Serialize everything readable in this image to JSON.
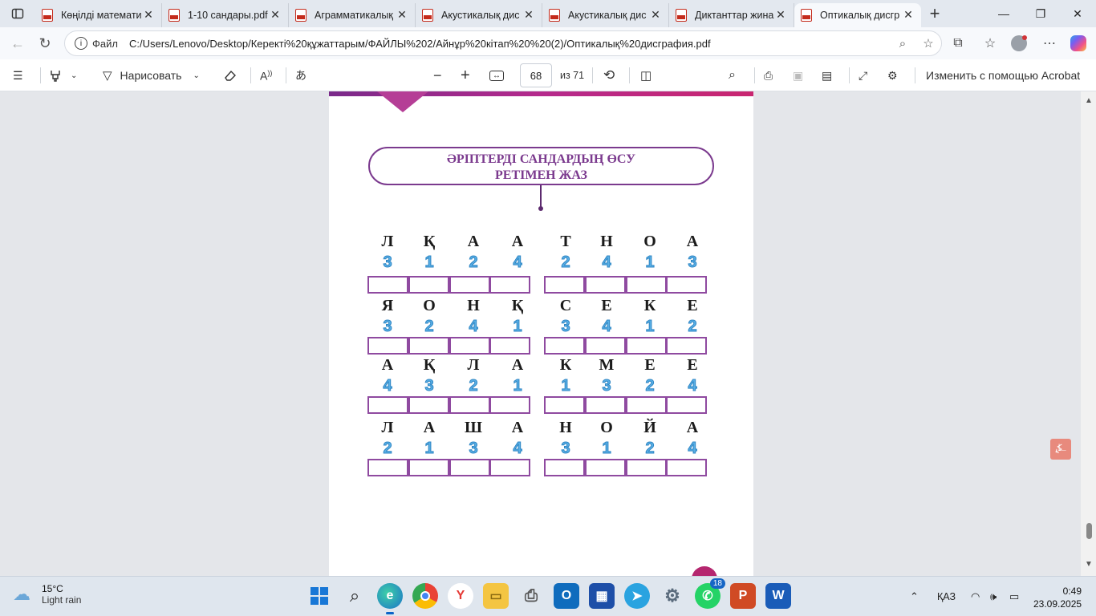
{
  "browser": {
    "tabs": [
      {
        "title": "Көңілді математи",
        "active": false
      },
      {
        "title": "1-10 сандары.pdf",
        "active": false
      },
      {
        "title": "Аграмматикалық",
        "active": false
      },
      {
        "title": "Акустикалық дис",
        "active": false
      },
      {
        "title": "Акустикалық дис",
        "active": false
      },
      {
        "title": "Диктанттар жина",
        "active": false
      },
      {
        "title": "Оптикалық дисгр",
        "active": true
      }
    ],
    "address": {
      "file_label": "Файл",
      "url": "C:/Users/Lenovo/Desktop/Керекті%20құжаттарым/ФАЙЛЫ%202/Айнұр%20кітап%20%20(2)/Оптикалық%20дисграфия.pdf"
    }
  },
  "pdf_toolbar": {
    "draw_label": "Нарисовать",
    "page_current": "68",
    "page_total": "из 71",
    "edit_acrobat": "Изменить с помощью Acrobat"
  },
  "document": {
    "title_line1": "ӘРІПТЕРДІ САНДАРДЫҢ ӨСУ",
    "title_line2": "РЕТІМЕН  ЖАЗ",
    "rows": [
      {
        "letters": [
          "Л",
          "Қ",
          "А",
          "А",
          "Т",
          "Н",
          "О",
          "А"
        ],
        "numbers": [
          "3",
          "1",
          "2",
          "4",
          "2",
          "4",
          "1",
          "3"
        ]
      },
      {
        "letters": [
          "Я",
          "О",
          "Н",
          "Қ",
          "С",
          "Е",
          "К",
          "Е"
        ],
        "numbers": [
          "3",
          "2",
          "4",
          "1",
          "3",
          "4",
          "1",
          "2"
        ]
      },
      {
        "letters": [
          "А",
          "Қ",
          "Л",
          "А",
          "К",
          "М",
          "Е",
          "Е"
        ],
        "numbers": [
          "4",
          "3",
          "2",
          "1",
          "1",
          "3",
          "2",
          "4"
        ]
      },
      {
        "letters": [
          "Л",
          "А",
          "Ш",
          "А",
          "Н",
          "О",
          "Й",
          "А"
        ],
        "numbers": [
          "2",
          "1",
          "3",
          "4",
          "3",
          "1",
          "2",
          "4"
        ]
      }
    ]
  },
  "taskbar": {
    "weather_temp": "15°C",
    "weather_desc": "Light rain",
    "telegram_badge": "18",
    "language": "ҚАЗ",
    "time": "0:49",
    "date": "23.09.2025"
  }
}
